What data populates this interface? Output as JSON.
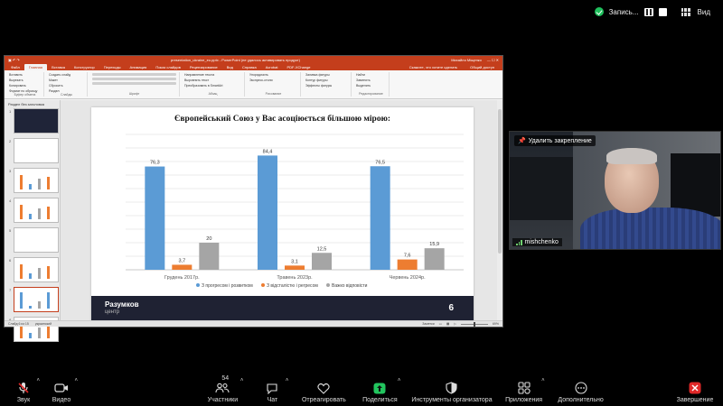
{
  "zoom_top": {
    "record_text": "Запись...",
    "view_label": "Вид"
  },
  "ppt": {
    "title": "presentation_ukraine_eu.pptx - PowerPoint (не удалось активировать продукт)",
    "user": "Михайло Міщенко",
    "tabs": [
      "Файл",
      "Главная",
      "Вставка",
      "Конструктор",
      "Переходы",
      "Анимация",
      "Показ слайдов",
      "Рецензирование",
      "Вид",
      "Справка",
      "Acrobat",
      "PDF-XChange"
    ],
    "active_tab_index": 1,
    "search_placeholder": "Скажите, что хотите сделать",
    "share_label": "Общий доступ",
    "ribbon_groups": [
      {
        "label": "Буфер обмена",
        "items": [
          "Вставить",
          "Вырезать",
          "Копировать",
          "Формат по образцу"
        ]
      },
      {
        "label": "Слайды",
        "items": [
          "Создать слайд",
          "Макет",
          "Сбросить",
          "Раздел"
        ]
      },
      {
        "label": "Шрифт",
        "items": []
      },
      {
        "label": "Абзац",
        "items": [
          "Направление текста",
          "Выровнять текст",
          "Преобразовать в SmartArt"
        ]
      },
      {
        "label": "Рисование",
        "items": [
          "Упорядочить",
          "Экспресс-стили"
        ]
      },
      {
        "label": "",
        "items": [
          "Заливка фигуры",
          "Контур фигуры",
          "Эффекты фигуры"
        ]
      },
      {
        "label": "Редактирование",
        "items": [
          "Найти",
          "Заменить",
          "Выделить"
        ]
      }
    ],
    "thumbs_header": "Раздел без заголовка",
    "status_left": "Слайд 6 из 15",
    "status_lang": "украинский",
    "status_notes": "Заметки",
    "status_zoom": "69%"
  },
  "slide": {
    "number": "6",
    "logo_main": "Разумков",
    "logo_sub": "центр"
  },
  "chart_data": {
    "type": "bar",
    "title": "Європейський Союз у Вас асоціюється більшою мірою:",
    "categories": [
      "Грудень 2017р.",
      "Травень 2023р.",
      "Червень 2024р."
    ],
    "series": [
      {
        "name": "З прогресом і розвитком",
        "color": "#5b9bd5",
        "values": [
          76.3,
          84.4,
          76.5
        ],
        "labels": [
          "76,3",
          "84,4",
          "76,5"
        ]
      },
      {
        "name": "З відсталістю і регресом",
        "color": "#ed7d31",
        "values": [
          3.7,
          3.1,
          7.6
        ],
        "labels": [
          "3,7",
          "3,1",
          "7,6"
        ]
      },
      {
        "name": "Важко відповісти",
        "color": "#a5a5a5",
        "values": [
          20,
          12.5,
          15.9
        ],
        "labels": [
          "20",
          "12,5",
          "15,9"
        ]
      }
    ],
    "ylim": [
      0,
      100
    ],
    "grid": true,
    "legend": "bottom"
  },
  "video": {
    "unpin_label": "Удалить закрепление",
    "participant_name": "mishchenko"
  },
  "toolbar": {
    "audio": "Звук",
    "video": "Видео",
    "participants": "Участники",
    "participants_count": "54",
    "chat": "Чат",
    "react": "Отреагировать",
    "share": "Поделиться",
    "host_tools": "Инструменты организатора",
    "apps": "Приложения",
    "more": "Дополнительно",
    "end": "Завершение"
  },
  "colors": {
    "ppt_accent": "#c43e1c",
    "share_green": "#22c55e",
    "end_red": "#e02828",
    "slide_footer": "#1f2233"
  }
}
